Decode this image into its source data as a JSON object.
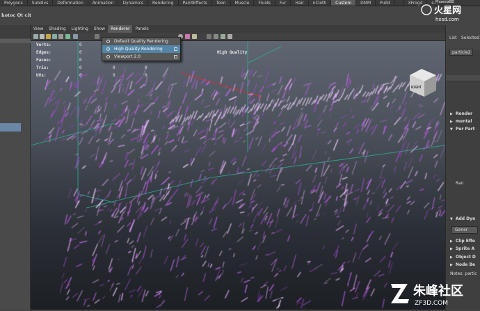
{
  "shelf_tabs": [
    "Polygons",
    "Subdivs",
    "Deformation",
    "Animation",
    "Dynamics",
    "Rendering",
    "PaintEffects",
    "Toon",
    "Muscle",
    "Fluids",
    "Fur",
    "Hair",
    "nCloth",
    "Custom",
    "DMM",
    "Pulld",
    "",
    "XFrog4",
    "s..."
  ],
  "shelf_active_tab": "Custom",
  "shelf_text": "hotoc Qt cit",
  "viewport_menu": [
    "View",
    "Shading",
    "Lighting",
    "Show",
    "Renderer",
    "Panels"
  ],
  "viewport_menu_open": "Renderer",
  "hud": {
    "labels": [
      "Verts:",
      "Edges:",
      "Faces:",
      "Tris:",
      "UVs:"
    ],
    "col1": [
      "0",
      "0",
      "0",
      "0",
      "0"
    ],
    "col2": [
      "0",
      "0",
      "0",
      "0",
      "0"
    ],
    "col3": [
      "0",
      "0",
      "0",
      "0",
      "0"
    ],
    "quality_label": "High Quality"
  },
  "renderer_menu": {
    "items": [
      "Default Quality Rendering",
      "High Quality Rendering",
      "Viewport 2.0"
    ],
    "selected": "High Quality Rendering"
  },
  "view_cube_face": "RIGHT",
  "right_panel": {
    "tabs": [
      "List",
      "Selected"
    ],
    "node_tab": "particle2",
    "sections": [
      "Render",
      "mental",
      "Per Part",
      "Add Dyn",
      "Clip Effe",
      "Sprite A",
      "Object D",
      "Node Be",
      "Notes: partic"
    ],
    "per_particle_field": "Ran",
    "button_label": "Gener"
  },
  "watermark_top": {
    "line1": "火星网",
    "line2": "hxsd.com",
    "line3": "PhoenixBD"
  },
  "watermark_bottom": {
    "line1": "朱峰社区",
    "line2": "ZF3D.COM"
  },
  "colors": {
    "particles": "#c86ef0",
    "menu_highlight": "#5285a6",
    "grid_line": "#2fb39a",
    "annotation_line": "#d23030"
  }
}
